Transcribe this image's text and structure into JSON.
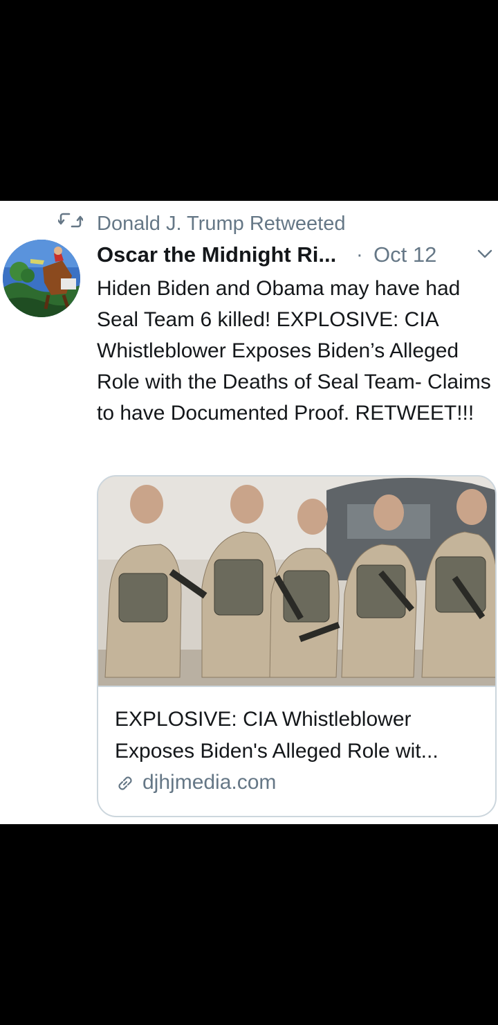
{
  "retweet_context": {
    "text": "Donald J. Trump Retweeted",
    "icon": "retweet-icon"
  },
  "tweet": {
    "display_name": "Oscar the Midnight Ri...",
    "separator": "·",
    "date": "Oct 12",
    "menu_icon": "chevron-down-icon",
    "text": "Hiden Biden and Obama may have had Seal Team 6 killed! EXPLOSIVE: CIA Whistleblower Exposes Biden’s Alleged Role with the Deaths of Seal Team- Claims to have Documented Proof. RETWEET!!!"
  },
  "card": {
    "title_line1": "EXPLOSIVE: CIA Whistleblower",
    "title_line2": "Exposes Biden's Alleged Role wit...",
    "domain": "djhjmedia.com",
    "domain_icon": "link-icon"
  },
  "colors": {
    "text_primary": "#14171a",
    "text_secondary": "#657786",
    "card_border": "#ccd6dd",
    "background_outside": "#000000",
    "tweet_background": "#ffffff"
  }
}
